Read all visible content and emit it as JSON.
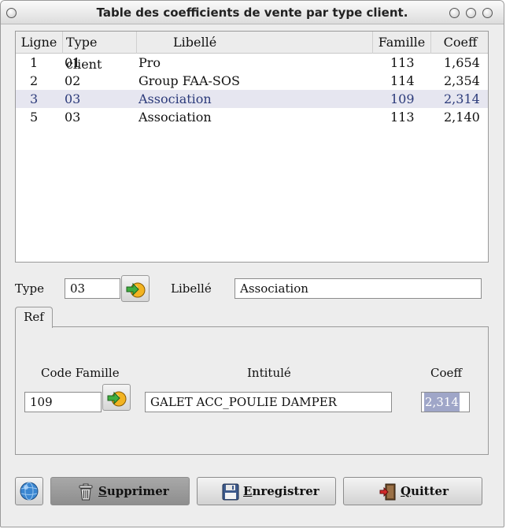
{
  "window": {
    "title": "Table des coefficients de vente par type client."
  },
  "table": {
    "columns": [
      "Ligne",
      "Type client",
      "Libellé",
      "Famille",
      "Coeff"
    ],
    "rows": [
      {
        "ligne": "1",
        "type": "01",
        "libelle": "Pro",
        "famille": "113",
        "coeff": "1,654"
      },
      {
        "ligne": "2",
        "type": "02",
        "libelle": "Group FAA-SOS",
        "famille": "114",
        "coeff": "2,354"
      },
      {
        "ligne": "3",
        "type": "03",
        "libelle": "Association",
        "famille": "109",
        "coeff": "2,314"
      },
      {
        "ligne": "5",
        "type": "03",
        "libelle": "Association",
        "famille": "113",
        "coeff": "2,140"
      }
    ],
    "selected_row": "3"
  },
  "form": {
    "type_label": "Type",
    "type_value": "03",
    "libelle_label": "Libellé",
    "libelle_value": "Association"
  },
  "tab": {
    "label": "Ref"
  },
  "ref": {
    "code_famille_label": "Code Famille",
    "intitule_label": "Intitulé",
    "coeff_label": "Coeff",
    "code_famille_value": "109",
    "intitule_value": "GALET ACC_POULIE DAMPER",
    "coeff_value": "2,314"
  },
  "buttons": {
    "supprimer_first": "S",
    "supprimer_rest": "upprimer",
    "enregistrer_first": "E",
    "enregistrer_rest": "nregistrer",
    "quitter_first": "Q",
    "quitter_rest": "uitter"
  },
  "icons": {
    "go": "arrow-right-icon",
    "help": "help-globe-icon",
    "trash": "trash-icon",
    "save": "floppy-disk-icon",
    "exit": "exit-door-icon"
  },
  "colors": {
    "selection": "#e6e6f0",
    "text_selection": "#9fa6c8"
  }
}
